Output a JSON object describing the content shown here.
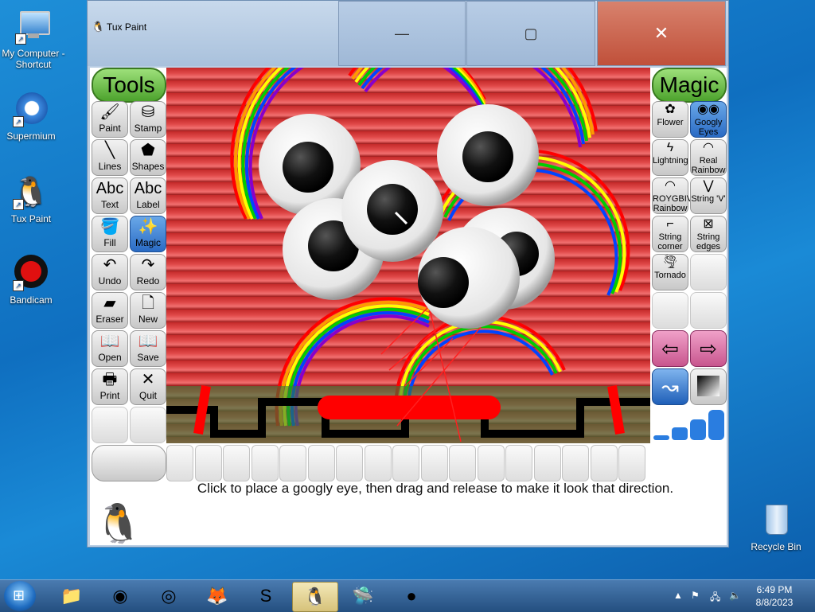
{
  "desktop": {
    "icons": [
      {
        "label": "My Computer - Shortcut"
      },
      {
        "label": "Supermium"
      },
      {
        "label": "Tux Paint"
      },
      {
        "label": "Bandicam"
      },
      {
        "label": "Recycle Bin"
      }
    ]
  },
  "window": {
    "title": "Tux Paint",
    "buttons": {
      "minimize": "—",
      "maximize": "▢",
      "close": "✕"
    }
  },
  "tools": {
    "header": "Tools",
    "items": [
      {
        "label": "Paint",
        "glyph": "🖌"
      },
      {
        "label": "Stamp",
        "glyph": "⛁"
      },
      {
        "label": "Lines",
        "glyph": "╲"
      },
      {
        "label": "Shapes",
        "glyph": "⬟"
      },
      {
        "label": "Text",
        "glyph": "Abc"
      },
      {
        "label": "Label",
        "glyph": "Abc"
      },
      {
        "label": "Fill",
        "glyph": "🪣"
      },
      {
        "label": "Magic",
        "glyph": "✨"
      },
      {
        "label": "Undo",
        "glyph": "↶"
      },
      {
        "label": "Redo",
        "glyph": "↷"
      },
      {
        "label": "Eraser",
        "glyph": "▰"
      },
      {
        "label": "New",
        "glyph": "🗋"
      },
      {
        "label": "Open",
        "glyph": "📖"
      },
      {
        "label": "Save",
        "glyph": "📖"
      },
      {
        "label": "Print",
        "glyph": "🖶"
      },
      {
        "label": "Quit",
        "glyph": "✕"
      }
    ]
  },
  "magic": {
    "header": "Magic",
    "items": [
      {
        "label": "Flower",
        "glyph": "✿"
      },
      {
        "label": "Googly Eyes",
        "glyph": "◉◉"
      },
      {
        "label": "Lightning",
        "glyph": "ϟ"
      },
      {
        "label": "Real Rainbow",
        "glyph": "◠"
      },
      {
        "label": "ROYGBIV Rainbow",
        "glyph": "◠"
      },
      {
        "label": "String 'V'",
        "glyph": "⋁"
      },
      {
        "label": "String corner",
        "glyph": "⌐"
      },
      {
        "label": "String edges",
        "glyph": "⊠"
      },
      {
        "label": "Tornado",
        "glyph": "🌪"
      }
    ],
    "nav": {
      "prev": "⇦",
      "next": "⇨"
    }
  },
  "status_message": "Click to place a googly eye, then drag and release to make it look that direction.",
  "taskbar": {
    "time": "6:49 PM",
    "date": "8/8/2023",
    "items": [
      {
        "name": "file-explorer",
        "glyph": "📁"
      },
      {
        "name": "chrome",
        "glyph": "◉"
      },
      {
        "name": "supermium",
        "glyph": "◎"
      },
      {
        "name": "firefox",
        "glyph": "🦊"
      },
      {
        "name": "app-s",
        "glyph": "S"
      },
      {
        "name": "tux-paint",
        "glyph": "🐧"
      },
      {
        "name": "ufo",
        "glyph": "🛸"
      },
      {
        "name": "bandicam",
        "glyph": "●"
      }
    ]
  }
}
